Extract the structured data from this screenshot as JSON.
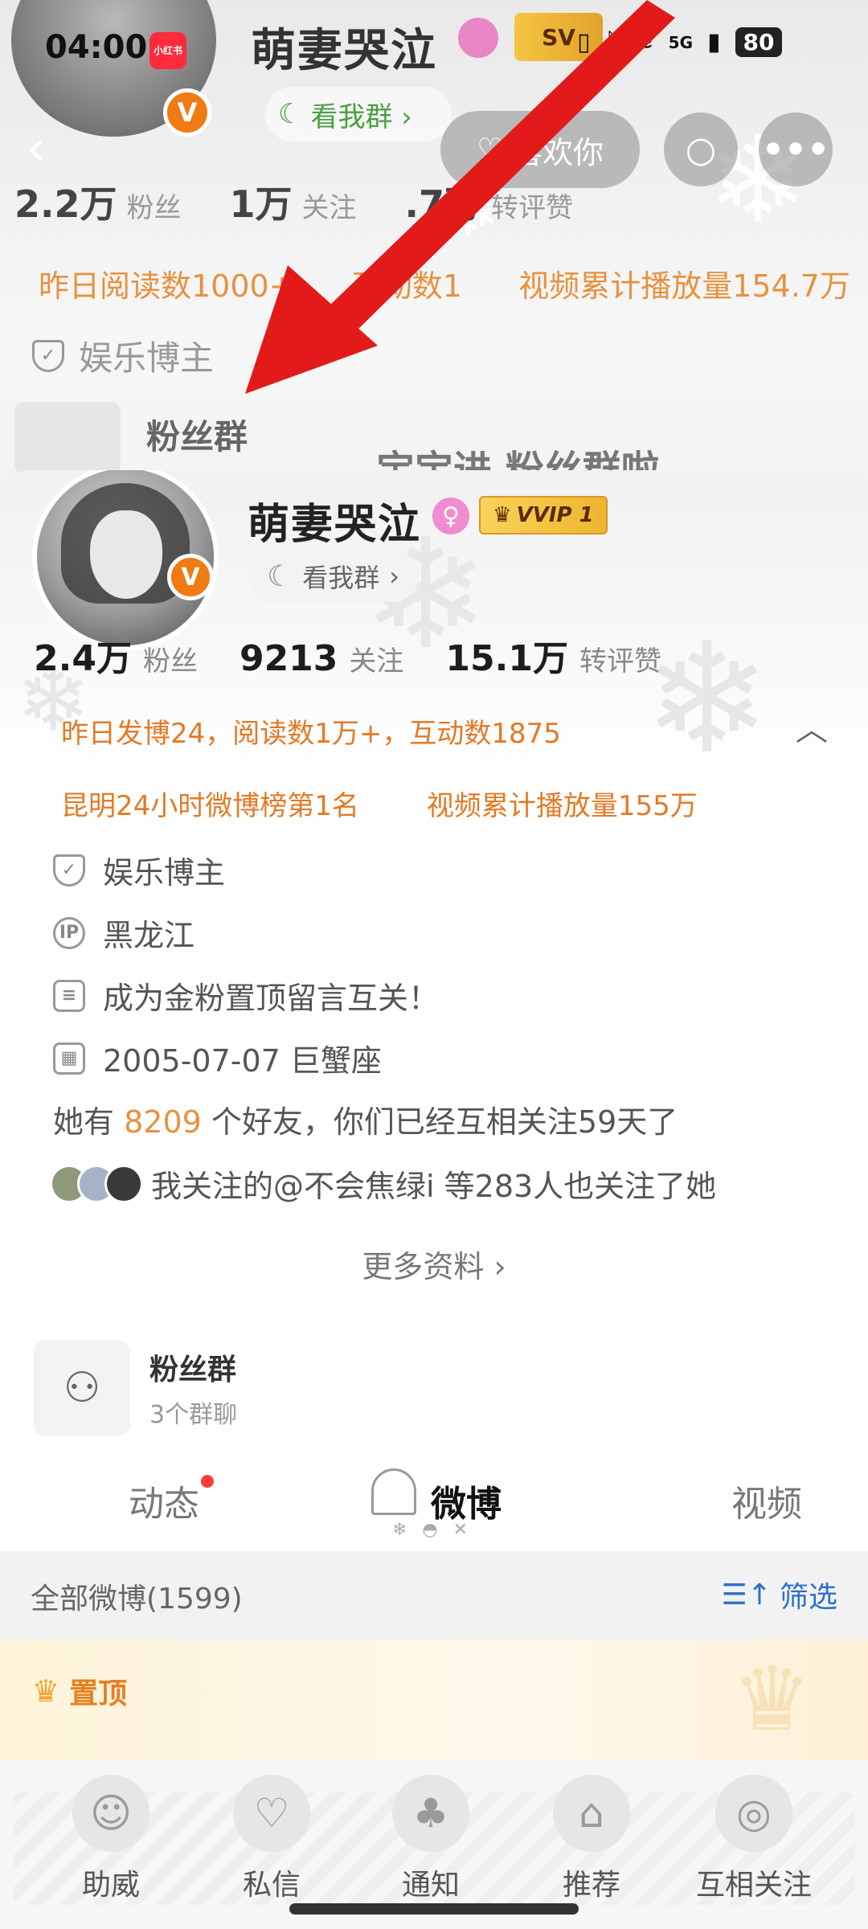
{
  "status_bar": {
    "time": "04:00",
    "app_badge": "小红书",
    "signal_label": "5G",
    "battery": "80"
  },
  "background_profile": {
    "name": "萌妻哭泣",
    "svip_label": "SV",
    "group_pill": "看我群 ›",
    "like_button": "喜欢你",
    "stats": [
      {
        "value": "2.2万",
        "label": "粉丝"
      },
      {
        "value": "1万",
        "label": "关注"
      },
      {
        "value": ".7万",
        "label": "转评赞"
      }
    ],
    "achievements": [
      "昨日阅读数1000+",
      "互动数1",
      "视频累计播放量154.7万"
    ],
    "blogger_tag": "娱乐博主",
    "fans_group_label": "粉丝群",
    "banner_text": "宝宝进 粉丝群啦"
  },
  "profile": {
    "name": "萌妻哭泣",
    "vip_label": "VVIP 1",
    "verified_icon": "V",
    "group_pill": "看我群",
    "stats": [
      {
        "value": "2.4万",
        "label": "粉丝"
      },
      {
        "value": "9213",
        "label": "关注"
      },
      {
        "value": "15.1万",
        "label": "转评赞"
      }
    ],
    "achievement_line1": "昨日发博24，阅读数1万+，互动数1875",
    "achievement_line2a": "昆明24小时微博榜第1名",
    "achievement_line2b": "视频累计播放量155万",
    "info": {
      "category": "娱乐博主",
      "ip": "黑龙江",
      "bio": "成为金粉置顶留言互关！",
      "birthday": "2005-07-07 巨蟹座"
    },
    "friends_prefix": "她有",
    "friends_count": "8209",
    "friends_suffix": "个好友，你们已经互相关注59天了",
    "mutual_follow_text": "我关注的@不会焦绿i 等283人也关注了她",
    "more_info": "更多资料 ›"
  },
  "fans_group": {
    "title": "粉丝群",
    "subtitle": "3个群聊"
  },
  "tabs": {
    "dynamic": "动态",
    "weibo": "微博",
    "video": "视频"
  },
  "feed": {
    "all_label": "全部微博(1599)",
    "filter_label": "筛选",
    "pinned_label": "置顶"
  },
  "bottom_nav": [
    {
      "label": "助威",
      "icon": "cheer-icon"
    },
    {
      "label": "私信",
      "icon": "message-icon"
    },
    {
      "label": "通知",
      "icon": "bell-icon"
    },
    {
      "label": "推荐",
      "icon": "house-icon"
    },
    {
      "label": "互相关注",
      "icon": "mutual-follow-icon"
    }
  ],
  "colors": {
    "accent_orange": "#e37a26",
    "link_blue": "#2e72c8",
    "arrow_red": "#e21a1a",
    "verified_orange": "#f07a14"
  }
}
